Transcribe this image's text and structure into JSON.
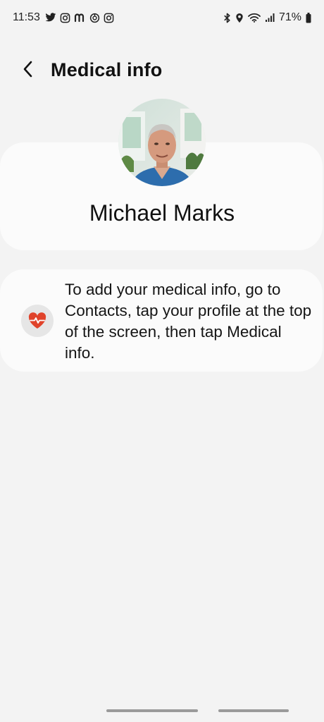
{
  "status_bar": {
    "time": "11:53",
    "notification_icons": [
      "twitter-icon",
      "instagram-icon",
      "m-app-icon",
      "circle-app-icon",
      "instagram-icon"
    ],
    "system_icons": [
      "bluetooth-icon",
      "location-icon",
      "wifi-icon",
      "signal-icon",
      "battery-icon"
    ],
    "battery_percent": "71%"
  },
  "header": {
    "title": "Medical info",
    "back_icon": "chevron-left-icon"
  },
  "profile": {
    "name": "Michael Marks",
    "avatar": "profile-photo"
  },
  "info_card": {
    "icon": "heart-pulse-icon",
    "text": "To add your medical info, go to Contacts, tap your profile at the top of the screen, then tap Medical info."
  },
  "colors": {
    "background": "#f3f3f3",
    "card": "#fbfbfb",
    "heart_accent": "#e0432b",
    "text": "#111111"
  }
}
